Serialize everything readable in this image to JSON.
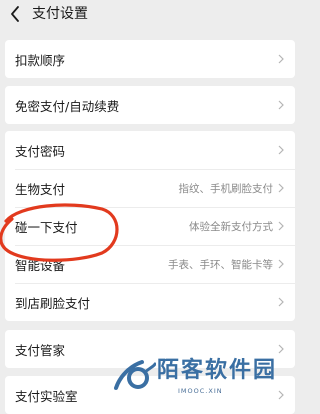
{
  "header": {
    "title": "支付设置"
  },
  "groups": [
    {
      "rows": [
        {
          "label": "扣款顺序",
          "value": ""
        }
      ]
    },
    {
      "rows": [
        {
          "label": "免密支付/自动续费",
          "value": ""
        }
      ]
    },
    {
      "rows": [
        {
          "label": "支付密码",
          "value": ""
        },
        {
          "label": "生物支付",
          "value": "指纹、手机刷脸支付"
        },
        {
          "label": "碰一下支付",
          "value": "体验全新支付方式"
        },
        {
          "label": "智能设备",
          "value": "手表、手环、智能卡等"
        },
        {
          "label": "到店刷脸支付",
          "value": ""
        }
      ]
    },
    {
      "rows": [
        {
          "label": "支付管家",
          "value": ""
        }
      ]
    },
    {
      "rows": [
        {
          "label": "支付实验室",
          "value": ""
        }
      ]
    }
  ],
  "annotation": {
    "ring_color": "#e23a1e"
  },
  "watermark": {
    "name": "陌客软件园",
    "domain": "IMOOC.XIN",
    "color": "#3a6fa3"
  },
  "colors": {
    "background": "#ededed",
    "card": "#ffffff",
    "secondary_text": "#8a8a8a"
  }
}
